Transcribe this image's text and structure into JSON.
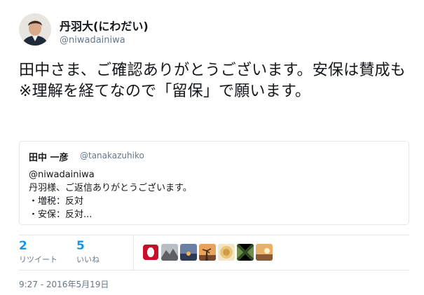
{
  "author": {
    "display_name": "丹羽大(にわだい)",
    "handle": "@niwadainiwa",
    "avatar_icon": "profile-photo"
  },
  "tweet": {
    "text": "田中さま、ご確認ありがとうございます。安保は賛成も※理解を経てなので「留保」で願います。"
  },
  "quote": {
    "author_name": "田中 一彦",
    "author_handle": "@tanakazuhiko",
    "lines": [
      "@niwadainiwa",
      "丹羽様、ご返信ありがとうございます。",
      "・増税：反対",
      "・安保：反対..."
    ]
  },
  "stats": {
    "retweets": {
      "count": "2",
      "label": "リツイート"
    },
    "likes": {
      "count": "5",
      "label": "いいね"
    }
  },
  "likers": [
    {
      "icon": "red-emblem-avatar",
      "color": "#c8102e"
    },
    {
      "icon": "mountain-photo-avatar",
      "color": "#8a8f94"
    },
    {
      "icon": "sunset-sea-avatar",
      "color": "#3b4f6e"
    },
    {
      "icon": "sunset-palm-avatar",
      "color": "#d98a3a"
    },
    {
      "icon": "food-avatar",
      "color": "#e7c77a"
    },
    {
      "icon": "green-pattern-avatar",
      "color": "#4a6b3a"
    },
    {
      "icon": "orange-sky-avatar",
      "color": "#c97a3f"
    }
  ],
  "timestamp": "9:27 - 2016年5月19日"
}
